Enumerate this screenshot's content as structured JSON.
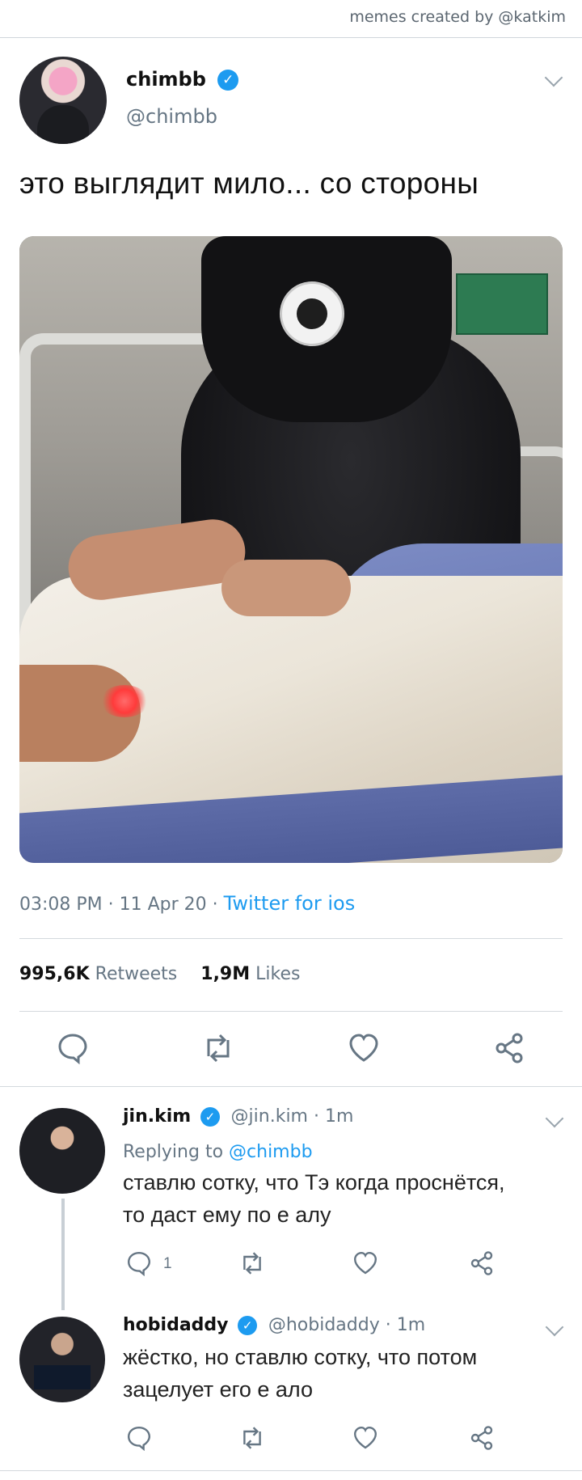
{
  "credit": "memes created by @katkim",
  "tweet": {
    "name": "chimbb",
    "handle": "@chimbb",
    "text": "это выглядит мило... со стороны",
    "time": "03:08 PM · 11 Apr 20 · ",
    "source": "Twitter for ios",
    "retweets_count": "995,6K",
    "retweets_label": "Retweets",
    "likes_count": "1,9M",
    "likes_label": "Likes"
  },
  "replies": [
    {
      "name": "jin.kim",
      "handle_time": "@jin.kim · 1m",
      "replying_prefix": "Replying to ",
      "replying_to": "@chimbb",
      "text_line1": "ставлю сотку, что Тэ когда проснётся,",
      "text_line2": "то даст ему по е алу",
      "reply_count": "1"
    },
    {
      "name": "hobidaddy",
      "handle_time": "@hobidaddy · 1m",
      "text_line1": "жёстко, но ставлю сотку, что потом",
      "text_line2": "зацелует его е ало"
    }
  ],
  "icons": {
    "verified": "✓",
    "reply": "reply-icon",
    "retweet": "retweet-icon",
    "like": "heart-icon",
    "share": "share-icon"
  },
  "colors": {
    "accent": "#1d9bf0",
    "muted": "#667684"
  }
}
